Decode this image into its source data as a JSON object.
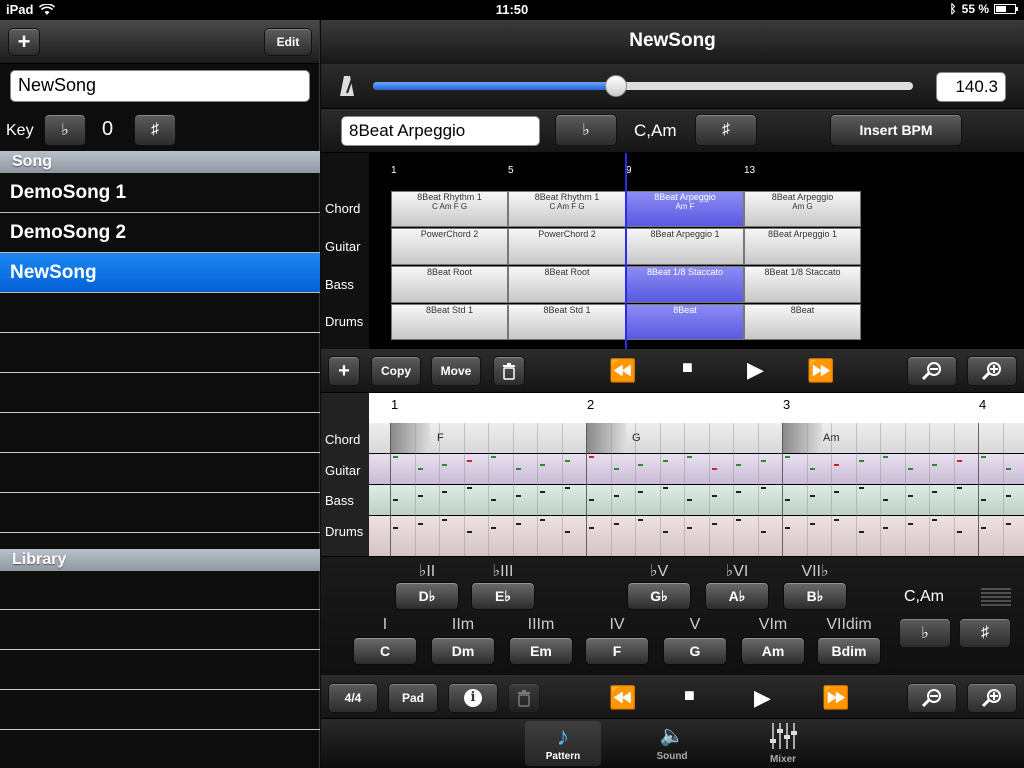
{
  "status": {
    "device": "iPad",
    "time": "11:50",
    "battery_pct": "55 %",
    "battery_level": 0.55
  },
  "left": {
    "add_label": "+",
    "edit_label": "Edit",
    "song_name_value": "NewSong",
    "key_label": "Key",
    "flat_label": "♭",
    "key_value": "0",
    "sharp_label": "♯",
    "song_section": "Song",
    "songs": [
      "DemoSong 1",
      "DemoSong 2",
      "NewSong"
    ],
    "library_section": "Library"
  },
  "right": {
    "title": "NewSong",
    "tempo_value": "140.3",
    "tempo_fraction": 0.45,
    "pattern_name": "8Beat Arpeggio",
    "flat_label": "♭",
    "chord_text": "C,Am",
    "sharp_label": "♯",
    "insert_bpm_label": "Insert BPM"
  },
  "arrangement": {
    "row_labels": [
      "Chord",
      "Guitar",
      "Bass",
      "Drums"
    ],
    "bars": [
      "1",
      "5",
      "9",
      "13"
    ],
    "chord_blocks": [
      {
        "name": "8Beat Rhythm 1",
        "chords": "C  Am  F  G"
      },
      {
        "name": "8Beat Rhythm 1",
        "chords": "C  Am  F  G"
      },
      {
        "name": "8Beat Arpeggio",
        "chords": "Am  F"
      },
      {
        "name": "8Beat Arpeggio",
        "chords": "Am  G"
      }
    ],
    "guitar_blocks": [
      "PowerChord 2",
      "PowerChord 2",
      "8Beat Arpeggio 1",
      "8Beat Arpeggio 1"
    ],
    "bass_blocks": [
      "8Beat Root",
      "8Beat Root",
      "8Beat 1/8 Staccato",
      "8Beat 1/8 Staccato"
    ],
    "drum_blocks": [
      "8Beat Std 1",
      "8Beat Std 1",
      "8Beat",
      "8Beat"
    ]
  },
  "arr_toolbar": {
    "add_label": "+",
    "copy_label": "Copy",
    "move_label": "Move"
  },
  "detail": {
    "beats": [
      "1",
      "2",
      "3",
      "4"
    ],
    "row_labels": [
      "Chord",
      "Guitar",
      "Bass",
      "Drums"
    ],
    "chords": [
      "F",
      "G",
      "Am"
    ]
  },
  "chord_pad": {
    "top_labels": [
      "♭II",
      "♭III",
      "♭V",
      "♭VI",
      "VII♭"
    ],
    "top_buttons": [
      "D♭",
      "E♭",
      "G♭",
      "A♭",
      "B♭"
    ],
    "bottom_labels": [
      "I",
      "IIm",
      "IIIm",
      "IV",
      "V",
      "VIm",
      "VIIdim"
    ],
    "bottom_buttons": [
      "C",
      "Dm",
      "Em",
      "F",
      "G",
      "Am",
      "Bdim"
    ],
    "key_text": "C,Am",
    "flat_label": "♭",
    "sharp_label": "♯"
  },
  "bottom_toolbar": {
    "time_sig_label": "4/4",
    "pad_label": "Pad"
  },
  "tabs": [
    {
      "label": "Pattern",
      "icon": "note-icon",
      "active": true
    },
    {
      "label": "Sound",
      "icon": "speaker-icon",
      "active": false
    },
    {
      "label": "Mixer",
      "icon": "mixer-icon",
      "active": false
    }
  ],
  "colors": {
    "accent": "#0a6fe8",
    "playhead": "#2a2af0",
    "selected_block": "#6b6bea"
  }
}
